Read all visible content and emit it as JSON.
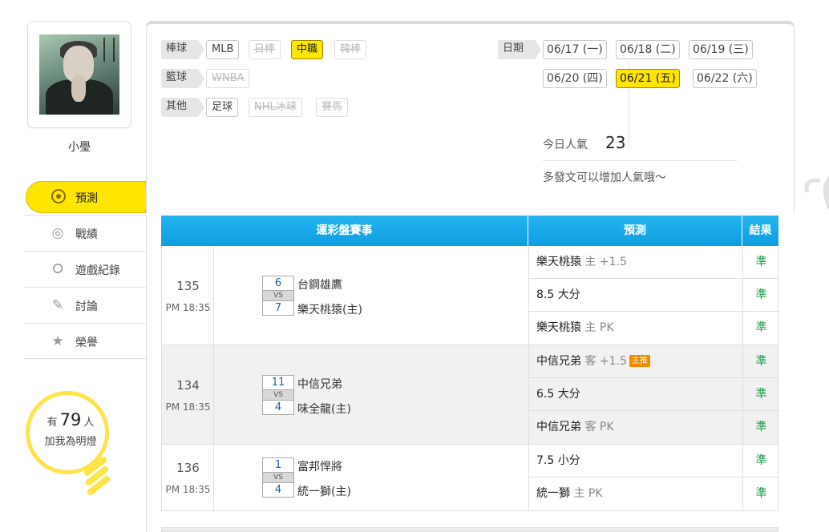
{
  "user": {
    "name": "小璺"
  },
  "nav": {
    "active": "預測",
    "items": [
      "戰績",
      "遊戲紀錄",
      "討論",
      "榮譽"
    ]
  },
  "fans": {
    "prefix": "有",
    "count": "79",
    "suffix": "人",
    "caption": "加我為明燈"
  },
  "filters": {
    "baseball_label": "棒球",
    "baseball": [
      "MLB",
      "日棒",
      "中職",
      "韓棒"
    ],
    "basketball_label": "籃球",
    "basketball": [
      "WNBA"
    ],
    "other_label": "其他",
    "other": [
      "足球",
      "NHL冰球",
      "賽馬"
    ],
    "active_league": "中職"
  },
  "dates": {
    "label": "日期",
    "items": [
      "06/17 (一)",
      "06/18 (二)",
      "06/19 (三)",
      "06/20 (四)",
      "06/21 (五)",
      "06/22 (六)"
    ],
    "active": "06/21 (五)"
  },
  "popularity": {
    "label": "今日人氣",
    "value": "23",
    "hint": "多發文可以增加人氣哦～"
  },
  "table": {
    "headers": {
      "match": "運彩盤賽事",
      "prediction": "預測",
      "result": "結果"
    },
    "games": [
      {
        "id": "135",
        "time": "PM 18:35",
        "away": {
          "score": "6",
          "team": "台鋼雄鷹"
        },
        "home": {
          "score": "7",
          "team": "樂天桃猿(主)"
        },
        "vs": "VS",
        "picks": [
          {
            "text": "樂天桃猿",
            "side": "主",
            "line": "+1.5",
            "result": "準"
          },
          {
            "text": "8.5 大分",
            "result": "準"
          },
          {
            "text": "樂天桃猿",
            "side": "主",
            "line": "PK",
            "result": "準"
          }
        ]
      },
      {
        "id": "134",
        "time": "PM 18:35",
        "away": {
          "score": "11",
          "team": "中信兄弟"
        },
        "home": {
          "score": "4",
          "team": "味全龍(主)"
        },
        "vs": "VS",
        "picks": [
          {
            "text": "中信兄弟",
            "side": "客",
            "line": "+1.5",
            "badge": "主推",
            "result": "準"
          },
          {
            "text": "6.5 大分",
            "result": "準"
          },
          {
            "text": "中信兄弟",
            "side": "客",
            "line": "PK",
            "result": "準"
          }
        ]
      },
      {
        "id": "136",
        "time": "PM 18:35",
        "away": {
          "score": "1",
          "team": "富邦悍將"
        },
        "home": {
          "score": "4",
          "team": "統一獅(主)"
        },
        "vs": "VS",
        "picks": [
          {
            "text": "7.5 小分",
            "result": "準"
          },
          {
            "text": "統一獅",
            "side": "主",
            "line": "PK",
            "result": "準"
          }
        ]
      }
    ]
  },
  "colors": {
    "accent_yellow": "#ffe600",
    "header_blue": "#1aa8ea",
    "result_green": "#1a9a4a",
    "badge_orange": "#f08a00"
  }
}
